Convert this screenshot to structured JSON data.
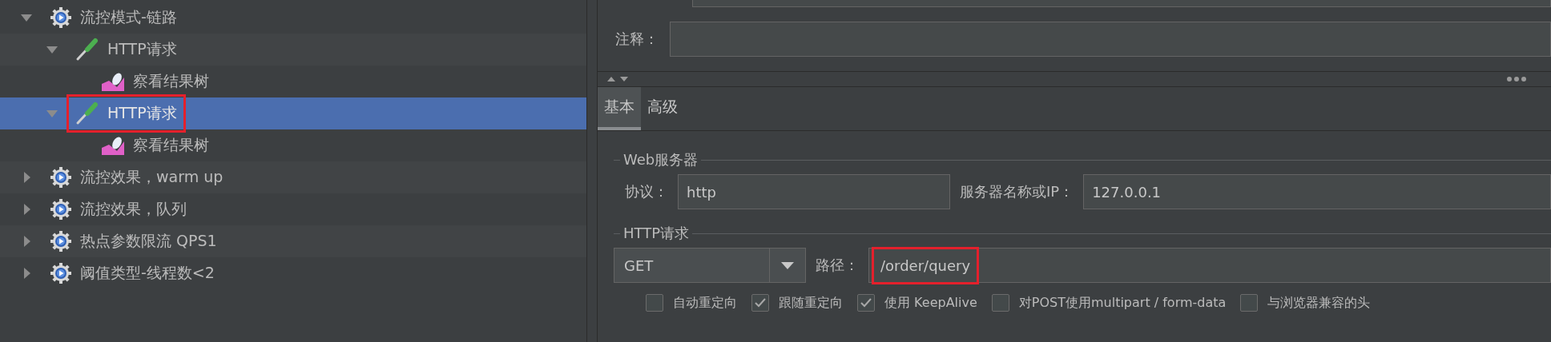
{
  "tree": [
    {
      "kind": "thread-group",
      "label": "流控模式-链路",
      "expanded": true,
      "selected": false,
      "highlighted": false,
      "children": [
        {
          "kind": "sampler",
          "label": "HTTP请求",
          "expanded": true,
          "selected": false,
          "highlighted": false,
          "children": [
            {
              "kind": "listener",
              "label": "察看结果树",
              "selected": false,
              "highlighted": false
            }
          ]
        },
        {
          "kind": "sampler",
          "label": "HTTP请求",
          "expanded": true,
          "selected": true,
          "highlighted": true,
          "children": [
            {
              "kind": "listener",
              "label": "察看结果树",
              "selected": false,
              "highlighted": false
            }
          ]
        }
      ]
    },
    {
      "kind": "thread-group",
      "label": "流控效果，warm up",
      "expanded": false,
      "selected": false,
      "highlighted": false
    },
    {
      "kind": "thread-group",
      "label": "流控效果，队列",
      "expanded": false,
      "selected": false,
      "highlighted": false
    },
    {
      "kind": "thread-group",
      "label": "热点参数限流 QPS1",
      "expanded": false,
      "selected": false,
      "highlighted": false
    },
    {
      "kind": "thread-group",
      "label": "阈值类型-线程数<2",
      "expanded": false,
      "selected": false,
      "highlighted": false
    }
  ],
  "comment": {
    "label": "注释："
  },
  "tabs": [
    {
      "label": "基本",
      "selected": true
    },
    {
      "label": "高级",
      "selected": false
    }
  ],
  "web_server": {
    "title": "Web服务器",
    "protocol": {
      "label": "协议：",
      "value": "http"
    },
    "server": {
      "label": "服务器名称或IP：",
      "value": "127.0.0.1"
    }
  },
  "http_request": {
    "title": "HTTP请求",
    "method": "GET",
    "path": {
      "label": "路径：",
      "value": "/order/query",
      "highlighted": true
    },
    "options": [
      {
        "label": "自动重定向",
        "checked": false
      },
      {
        "label": "跟随重定向",
        "checked": true
      },
      {
        "label": "使用 KeepAlive",
        "checked": true
      },
      {
        "label": "对POST使用multipart / form-data",
        "checked": false
      },
      {
        "label": "与浏览器兼容的头",
        "checked": false
      }
    ]
  }
}
